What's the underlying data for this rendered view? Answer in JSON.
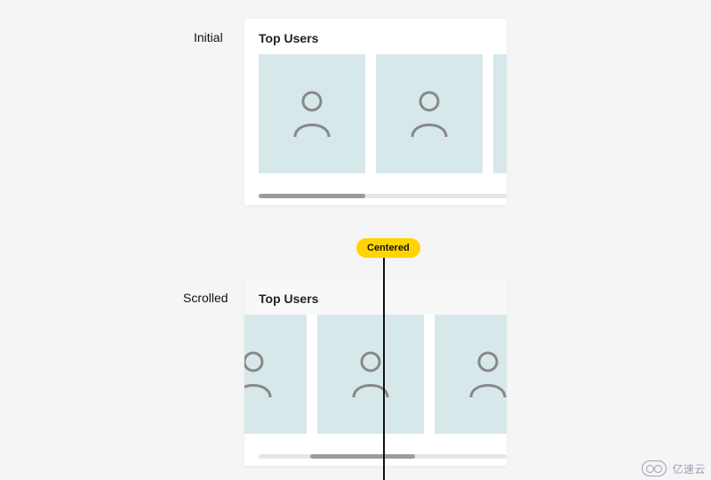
{
  "labels": {
    "initial": "Initial",
    "scrolled": "Scrolled"
  },
  "pill": "Centered",
  "panel_title": "Top Users",
  "watermark": "亿速云"
}
